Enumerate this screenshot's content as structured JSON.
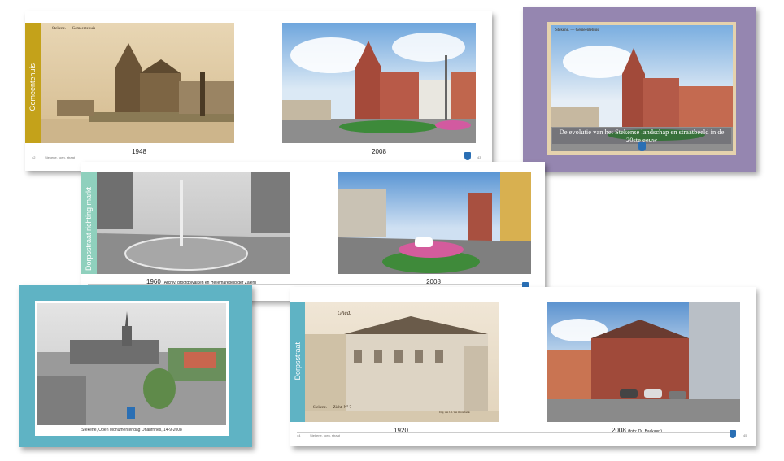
{
  "colors": {
    "mustard": "#c4a21a",
    "lavender": "#9586b0",
    "mint": "#8fd0bd",
    "teal": "#5fb3c4",
    "crest_blue": "#2a6fb4"
  },
  "spread1": {
    "tab_label": "Gemeentehuis",
    "left_caption": "1948",
    "right_caption": "2008",
    "old_title": "Stekene. — Gemeentehuis",
    "page_left": "42",
    "page_right": "43",
    "footer_text": "Stekene, toen, straat"
  },
  "cover": {
    "old_title": "Stekene. — Gemeentehuis",
    "banner": "De evolutie van het Stekense landschap en straatbeeld in de 20ste eeuw"
  },
  "spread2": {
    "tab_label": "Dorpsstraat richting markt",
    "left_caption_year": "1960",
    "left_caption_note": "(Archiv. grootgolvalken en Heilemarkbeld der Zalen)",
    "right_caption": "2008",
    "footer_text": "Stekene, toen, straat"
  },
  "card": {
    "caption": "Stekene, Open Monumentendag Ohanfrines, 14-9-2008"
  },
  "spread3": {
    "tab_label": "Dorpsstraat",
    "left_caption": "1920",
    "right_caption": "2008",
    "right_caption_note": "(foto: Dr. Backaert)",
    "postcard_text": "Stekene. — Zicht. N° 7",
    "postcard_script": "Ghed.",
    "postcard_publisher": "Uitg. van J.O. Van Overschelde",
    "page_left": "44",
    "page_right": "45",
    "footer_text": "Stekene, toen, straat"
  }
}
